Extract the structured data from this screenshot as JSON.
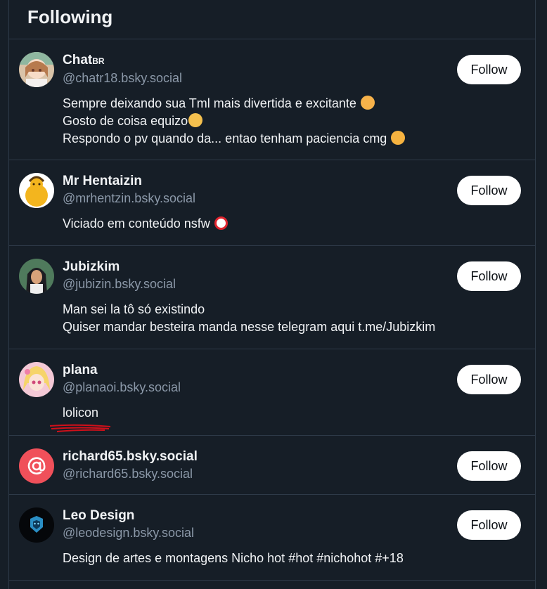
{
  "header": {
    "title": "Following"
  },
  "follow_label": "Follow",
  "users": [
    {
      "name": "Chat",
      "name_suffix": "BR",
      "handle": "@chatr18.bsky.social",
      "bio": [
        "Sempre deixando sua Tml mais divertida e excitante",
        "Gosto de coisa equizo",
        "Respondo o pv quando da... entao tenham paciencia cmg"
      ]
    },
    {
      "name": "Mr Hentaizin",
      "handle": "@mrhentzin.bsky.social",
      "bio": [
        "Viciado em conteúdo  nsfw"
      ]
    },
    {
      "name": "Jubizkim",
      "handle": "@jubizin.bsky.social",
      "bio": [
        "Man sei la tô só existindo",
        "Quiser mandar besteira manda nesse telegram aqui t.me/Jubizkim"
      ]
    },
    {
      "name": "plana",
      "handle": "@planaoi.bsky.social",
      "bio": [
        "lolicon"
      ]
    },
    {
      "name": "richard65.bsky.social",
      "handle": "@richard65.bsky.social",
      "bio": []
    },
    {
      "name": "Leo Design",
      "handle": "@leodesign.bsky.social",
      "bio": [
        "Design de artes e montagens Nicho hot #hot #nichohot #+18"
      ]
    }
  ],
  "colors": {
    "background": "#161e27",
    "divider": "#2e3a48",
    "handle": "#8b98a8",
    "follow_button": "#ffffff",
    "default_avatar": "#f0505a",
    "annotation_red": "#d0101a"
  },
  "icons": {
    "default_avatar": "at-sign-icon",
    "nsfw_emoji": "no-under-18-icon"
  }
}
